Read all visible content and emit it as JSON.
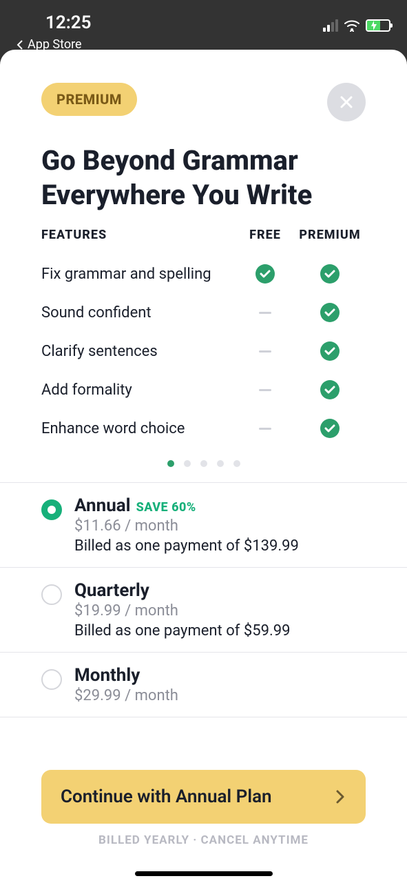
{
  "status": {
    "time": "12:25",
    "back_label": "App Store"
  },
  "badge": "PREMIUM",
  "headline": "Go Beyond Grammar Everywhere You Write",
  "columns": {
    "features": "FEATURES",
    "free": "FREE",
    "premium": "PREMIUM"
  },
  "features": [
    {
      "label": "Fix grammar and spelling",
      "free": true,
      "premium": true
    },
    {
      "label": "Sound confident",
      "free": false,
      "premium": true
    },
    {
      "label": "Clarify sentences",
      "free": false,
      "premium": true
    },
    {
      "label": "Add formality",
      "free": false,
      "premium": true
    },
    {
      "label": "Enhance word choice",
      "free": false,
      "premium": true
    }
  ],
  "page_dots": {
    "count": 5,
    "active": 0
  },
  "plans": [
    {
      "id": "annual",
      "title": "Annual",
      "save": "SAVE 60%",
      "price": "$11.66 / month",
      "billing": "Billed as one payment of $139.99",
      "selected": true
    },
    {
      "id": "quarterly",
      "title": "Quarterly",
      "save": "",
      "price": "$19.99 / month",
      "billing": "Billed as one payment of $59.99",
      "selected": false
    },
    {
      "id": "monthly",
      "title": "Monthly",
      "save": "",
      "price": "$29.99 / month",
      "billing": "",
      "selected": false
    }
  ],
  "cta": "Continue with Annual Plan",
  "footer": "BILLED YEARLY · CANCEL ANYTIME"
}
